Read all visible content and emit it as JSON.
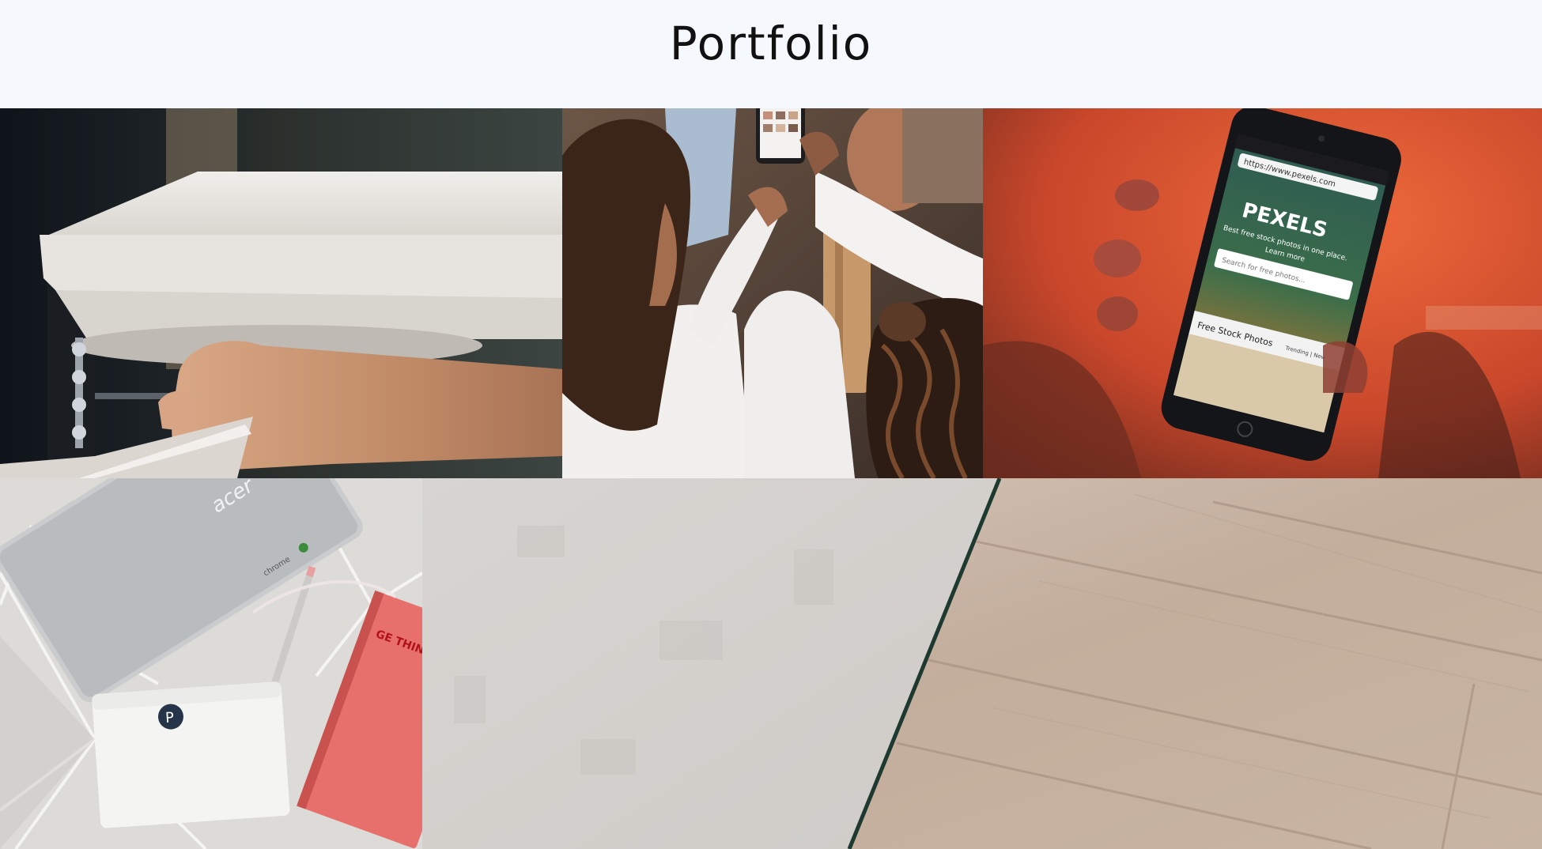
{
  "header": {
    "title": "Portfolio"
  },
  "gallery": {
    "items": [
      {
        "id": "sink",
        "description_icon": "photo-icon"
      },
      {
        "id": "friends-phone",
        "description_icon": "photo-icon"
      },
      {
        "id": "pexels-phone",
        "description_icon": "photo-icon"
      },
      {
        "id": "laptop-desk",
        "description_icon": "photo-icon"
      },
      {
        "id": "wood-floor",
        "description_icon": "photo-icon"
      }
    ],
    "phone_screen": {
      "brand": "PEXELS",
      "tagline": "Best free stock photos in one place.",
      "link": "Learn more",
      "search_placeholder": "Search for free photos...",
      "section": "Free Stock Photos",
      "tab": "Trending | New",
      "url": "https://www.pexels.com"
    },
    "notebook_text": "GE THING",
    "laptop_logo": "acer",
    "laptop_badge": "chrome",
    "tissue_logo": "P"
  }
}
